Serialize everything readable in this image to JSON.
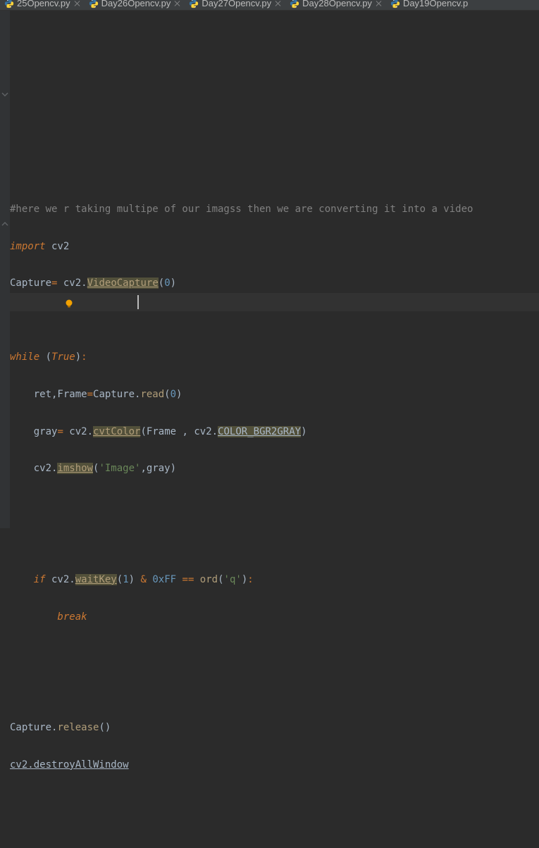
{
  "tabs": [
    {
      "label": "25Opencv.py"
    },
    {
      "label": "Day26Opencv.py"
    },
    {
      "label": "Day27Opencv.py"
    },
    {
      "label": "Day28Opencv.py"
    },
    {
      "label": "Day19Opencv.p"
    }
  ],
  "code": {
    "l1_comment": "#here we r taking multipe of our imagss then we are converting it into a video",
    "l2_import": "import",
    "l2_cv2": " cv2",
    "l3_capture": "Capture",
    "l3_eq": "=",
    "l3_cv2dot": " cv2.",
    "l3_videoCapture": "VideoCapture",
    "l3_paren_o": "(",
    "l3_zero": "0",
    "l3_paren_c": ")",
    "l5_while": "while",
    "l5_sp_paren": " (",
    "l5_true": "True",
    "l5_close": ")",
    "l5_colon": ":",
    "l6_ret": "    ret,Frame",
    "l6_eq": "=",
    "l6_cap": "Capture.",
    "l6_read": "read",
    "l6_o": "(",
    "l6_zero": "0",
    "l6_c": ")",
    "l7_gray": "    gray",
    "l7_eq": "=",
    "l7_cv2": " cv2.",
    "l7_cvt": "cvtColor",
    "l7_o": "(",
    "l7_frame": "Frame , cv2.",
    "l7_const": "COLOR_BGR2GRAY",
    "l7_c": ")",
    "l8_cv2": "    cv2.",
    "l8_imshow": "imshow",
    "l8_o": "(",
    "l8_str": "'Image'",
    "l8_rest": ",gray)",
    "l11_if": "    if",
    "l11_cv2": " cv2.",
    "l11_wait": "waitKey",
    "l11_o": "(",
    "l11_one": "1",
    "l11_c": ")",
    "l11_sp": " ",
    "l11_amp": "&",
    "l11_hex": " 0xFF ",
    "l11_eqeq": "==",
    "l11_ord": " ord",
    "l11_o2": "(",
    "l11_q": "'q'",
    "l11_c2": ")",
    "l11_colon": ":",
    "l12_break": "        break",
    "l15_cap": "Capture.",
    "l15_rel": "release",
    "l15_p": "()",
    "l16_err": "cv2.destroyAllWindow"
  },
  "gutter": {
    "collapse_while_top": "⌄",
    "collapse_if_top": "⌄"
  }
}
